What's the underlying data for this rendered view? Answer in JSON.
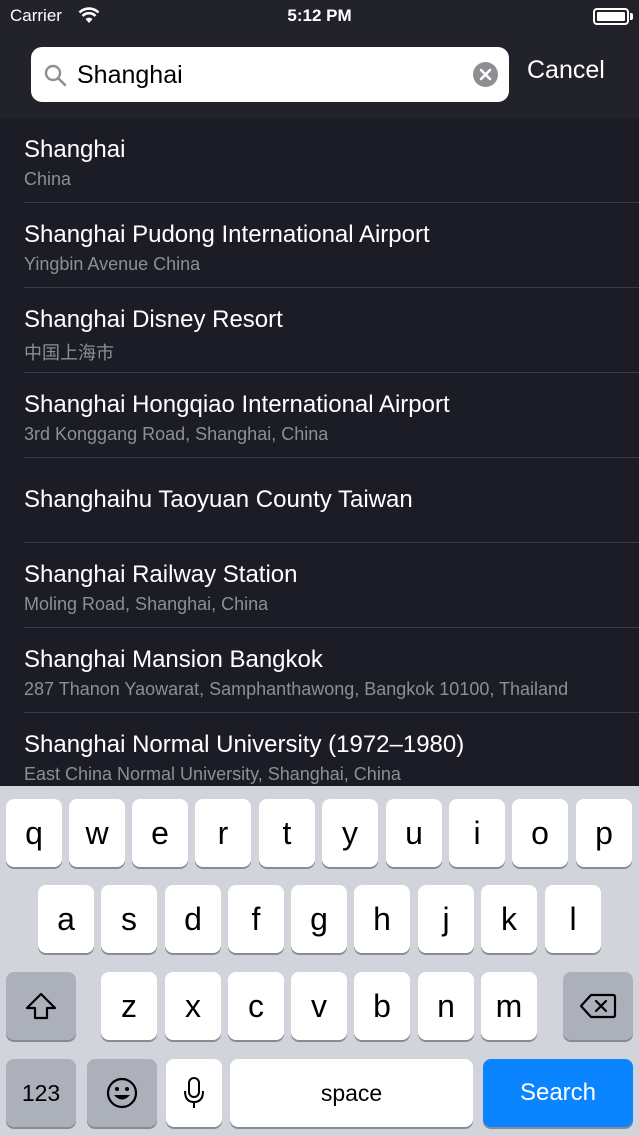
{
  "status_bar": {
    "carrier": "Carrier",
    "time": "5:12 PM"
  },
  "search": {
    "value": "Shanghai",
    "placeholder": "",
    "cancel_label": "Cancel"
  },
  "results": [
    {
      "title": "Shanghai",
      "subtitle": "China"
    },
    {
      "title": "Shanghai Pudong International Airport",
      "subtitle": "Yingbin Avenue China"
    },
    {
      "title": "Shanghai Disney Resort",
      "subtitle": "中国上海市"
    },
    {
      "title": "Shanghai Hongqiao International Airport",
      "subtitle": "3rd Konggang Road, Shanghai, China"
    },
    {
      "title": "Shanghaihu Taoyuan County Taiwan",
      "subtitle": ""
    },
    {
      "title": "Shanghai Railway Station",
      "subtitle": "Moling Road, Shanghai, China"
    },
    {
      "title": "Shanghai Mansion Bangkok",
      "subtitle": "287 Thanon Yaowarat, Samphanthawong, Bangkok 10100, Thailand"
    },
    {
      "title": "Shanghai Normal University (1972–1980)",
      "subtitle": "East China Normal University, Shanghai, China"
    }
  ],
  "keyboard": {
    "row1": [
      "q",
      "w",
      "e",
      "r",
      "t",
      "y",
      "u",
      "i",
      "o",
      "p"
    ],
    "row2": [
      "a",
      "s",
      "d",
      "f",
      "g",
      "h",
      "j",
      "k",
      "l"
    ],
    "row3": [
      "z",
      "x",
      "c",
      "v",
      "b",
      "n",
      "m"
    ],
    "numbers_label": "123",
    "space_label": "space",
    "search_label": "Search"
  },
  "colors": {
    "accent": "#0a84ff",
    "background": "#1c1c27",
    "keyboard": "#d1d4db"
  }
}
